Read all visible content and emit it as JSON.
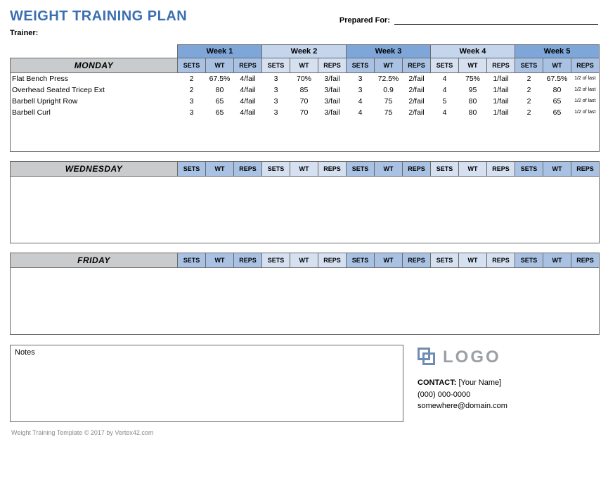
{
  "title": "WEIGHT TRAINING PLAN",
  "trainer_label": "Trainer:",
  "prepared_label": "Prepared For:",
  "weeks": [
    "Week 1",
    "Week 2",
    "Week 3",
    "Week 4",
    "Week 5"
  ],
  "sub_headers": [
    "SETS",
    "WT",
    "REPS"
  ],
  "days": {
    "mon": "MONDAY",
    "wed": "WEDNESDAY",
    "fri": "FRIDAY"
  },
  "exercises": [
    {
      "name": "Flat Bench Press",
      "weeks": [
        {
          "sets": "2",
          "wt": "67.5%",
          "reps": "4/fail"
        },
        {
          "sets": "3",
          "wt": "70%",
          "reps": "3/fail"
        },
        {
          "sets": "3",
          "wt": "72.5%",
          "reps": "2/fail"
        },
        {
          "sets": "4",
          "wt": "75%",
          "reps": "1/fail"
        },
        {
          "sets": "2",
          "wt": "67.5%",
          "reps": "1/2 of last"
        }
      ]
    },
    {
      "name": "Overhead Seated Tricep Ext",
      "weeks": [
        {
          "sets": "2",
          "wt": "80",
          "reps": "4/fail"
        },
        {
          "sets": "3",
          "wt": "85",
          "reps": "3/fail"
        },
        {
          "sets": "3",
          "wt": "0.9",
          "reps": "2/fail"
        },
        {
          "sets": "4",
          "wt": "95",
          "reps": "1/fail"
        },
        {
          "sets": "2",
          "wt": "80",
          "reps": "1/2 of last"
        }
      ]
    },
    {
      "name": "Barbell Upright Row",
      "weeks": [
        {
          "sets": "3",
          "wt": "65",
          "reps": "4/fail"
        },
        {
          "sets": "3",
          "wt": "70",
          "reps": "3/fail"
        },
        {
          "sets": "4",
          "wt": "75",
          "reps": "2/fail"
        },
        {
          "sets": "5",
          "wt": "80",
          "reps": "1/fail"
        },
        {
          "sets": "2",
          "wt": "65",
          "reps": "1/2 of last"
        }
      ]
    },
    {
      "name": "Barbell Curl",
      "weeks": [
        {
          "sets": "3",
          "wt": "65",
          "reps": "4/fail"
        },
        {
          "sets": "3",
          "wt": "70",
          "reps": "3/fail"
        },
        {
          "sets": "4",
          "wt": "75",
          "reps": "2/fail"
        },
        {
          "sets": "4",
          "wt": "80",
          "reps": "1/fail"
        },
        {
          "sets": "2",
          "wt": "65",
          "reps": "1/2 of last"
        }
      ]
    }
  ],
  "notes_label": "Notes",
  "logo_text": "LOGO",
  "contact": {
    "label": "CONTACT:",
    "name": "[Your Name]",
    "phone": "(000) 000-0000",
    "email": "somewhere@domain.com"
  },
  "footer": "Weight Training Template © 2017 by Vertex42.com"
}
